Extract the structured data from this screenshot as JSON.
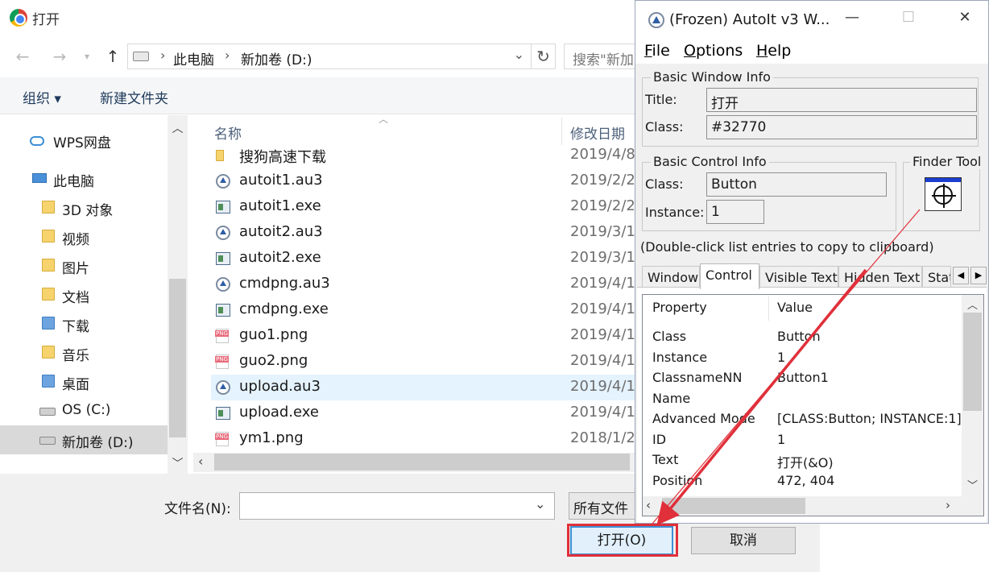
{
  "dialog": {
    "title": "打开",
    "breadcrumb": [
      "此电脑",
      "新加卷 (D:)"
    ],
    "search_placeholder": "搜索\"新加",
    "commands": {
      "organize": "组织 ▾",
      "new_folder": "新建文件夹"
    },
    "nav_items": [
      {
        "label": "WPS网盘",
        "icon": "cloud"
      },
      {
        "label": "此电脑",
        "icon": "pc"
      },
      {
        "label": "3D 对象",
        "icon": "folder"
      },
      {
        "label": "视频",
        "icon": "folder"
      },
      {
        "label": "图片",
        "icon": "folder"
      },
      {
        "label": "文档",
        "icon": "folder"
      },
      {
        "label": "下载",
        "icon": "folder-blue"
      },
      {
        "label": "音乐",
        "icon": "folder"
      },
      {
        "label": "桌面",
        "icon": "folder-blue"
      },
      {
        "label": "OS (C:)",
        "icon": "drive"
      },
      {
        "label": "新加卷 (D:)",
        "icon": "drive",
        "selected": true
      }
    ],
    "columns": {
      "name": "名称",
      "date": "修改日期"
    },
    "files": [
      {
        "name": "搜狗高速下载",
        "date": "2019/4/8",
        "type": "folder"
      },
      {
        "name": "autoit1.au3",
        "date": "2019/2/2",
        "type": "au3"
      },
      {
        "name": "autoit1.exe",
        "date": "2019/2/2",
        "type": "exe"
      },
      {
        "name": "autoit2.au3",
        "date": "2019/3/1",
        "type": "au3"
      },
      {
        "name": "autoit2.exe",
        "date": "2019/3/1",
        "type": "exe"
      },
      {
        "name": "cmdpng.au3",
        "date": "2019/4/1",
        "type": "au3"
      },
      {
        "name": "cmdpng.exe",
        "date": "2019/4/1",
        "type": "exe"
      },
      {
        "name": "guo1.png",
        "date": "2019/4/1",
        "type": "png"
      },
      {
        "name": "guo2.png",
        "date": "2019/4/1",
        "type": "png"
      },
      {
        "name": "upload.au3",
        "date": "2019/4/1",
        "type": "au3",
        "selected": true
      },
      {
        "name": "upload.exe",
        "date": "2019/4/1",
        "type": "exe"
      },
      {
        "name": "ym1.png",
        "date": "2018/1/2",
        "type": "png"
      }
    ],
    "filename_label": "文件名(N):",
    "filename_value": "",
    "filetype_label": "所有文件",
    "open_label": "打开(O)",
    "cancel_label": "取消"
  },
  "autoit": {
    "title": "(Frozen) AutoIt v3 W...",
    "menu": [
      {
        "label": "File",
        "underline": "F",
        "rest": "ile"
      },
      {
        "label": "Options",
        "underline": "O",
        "rest": "ptions"
      },
      {
        "label": "Help",
        "underline": "H",
        "rest": "elp"
      }
    ],
    "basic_window": {
      "group_label": "Basic Window Info",
      "title_label": "Title:",
      "title_value": "打开",
      "class_label": "Class:",
      "class_value": "#32770"
    },
    "basic_control": {
      "group_label": "Basic Control Info",
      "class_label": "Class:",
      "class_value": "Button",
      "instance_label": "Instance:",
      "instance_value": "1"
    },
    "finder_tool_label": "Finder Tool",
    "hint": "(Double-click list entries to copy to clipboard)",
    "tabs": [
      "Window",
      "Control",
      "Visible Text",
      "Hidden Text",
      "StatusBar"
    ],
    "selected_tab": "Control",
    "list_headers": {
      "property": "Property",
      "value": "Value"
    },
    "properties": [
      {
        "key": "Class",
        "value": "Button"
      },
      {
        "key": "Instance",
        "value": "1"
      },
      {
        "key": "ClassnameNN",
        "value": "Button1"
      },
      {
        "key": "Name",
        "value": ""
      },
      {
        "key": "Advanced Mode",
        "value": "[CLASS:Button; INSTANCE:1]"
      },
      {
        "key": "ID",
        "value": "1"
      },
      {
        "key": "Text",
        "value": "打开(&O)"
      },
      {
        "key": "Position",
        "value": "472, 404"
      }
    ]
  },
  "colors": {
    "highlight": "#e0303a",
    "selection": "#e5f3ff",
    "accent": "#3d8fd6"
  }
}
